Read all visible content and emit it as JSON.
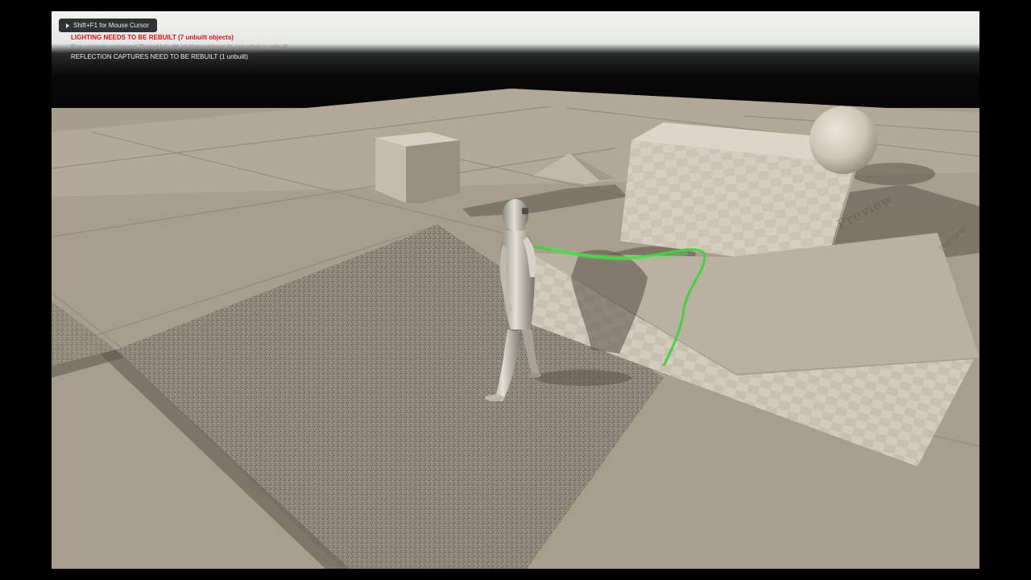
{
  "viewport": {
    "hint_button": "Shift+F1 for Mouse Cursor",
    "messages": {
      "lighting": "LIGHTING NEEDS TO BE REBUILT (7 unbuilt objects)",
      "console": "Run console command 'DumpUnbuiltLightInteractions' to see what is unbuilt",
      "reflection": "REFLECTION CAPTURES NEED TO BE REBUILT (1 unbuilt)"
    },
    "watermark_texts": [
      "Preview",
      "Preview"
    ]
  },
  "colors": {
    "floor": "#a79d8c",
    "warning_red": "#d01414",
    "trail_green": "#3fd23a",
    "character_metal": "#c9c4b6"
  },
  "icons": {
    "hint_button": "play-triangle-icon"
  }
}
